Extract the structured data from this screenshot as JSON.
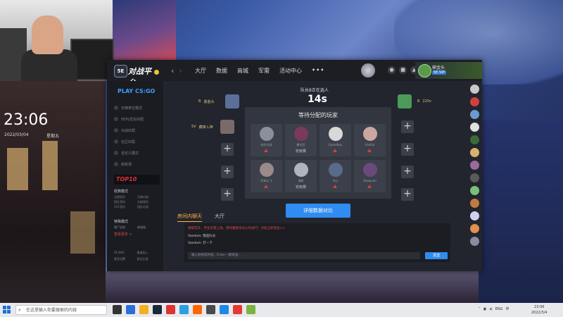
{
  "overlay": {
    "clock": "23:06",
    "date": "2022/03/04",
    "weekday": "星期五"
  },
  "app": {
    "logo_badge": "5E",
    "logo_text": "对战平台",
    "nav": [
      "大厅",
      "数据",
      "商城",
      "军需",
      "活动中心",
      "•••"
    ],
    "user": {
      "name": "鼎金头",
      "tag": "5E VIP"
    }
  },
  "sidebar": {
    "play_label": "PLAY CS:GO",
    "menu": [
      "天梯排位模式",
      "5EPL优先匹配",
      "对战匹配",
      "社区匹配",
      "自定义模式",
      "练枪场"
    ],
    "top_banner": "TOP10",
    "classic": {
      "title": "经典模式",
      "items": [
        "全模竞技",
        "天梯对战",
        "团队竞技",
        "天梯竞技",
        "1V1竞技",
        "组队对战"
      ]
    },
    "special": {
      "title": "特殊模式",
      "items": [
        "僵尸逃跑",
        "躲猫猫"
      ]
    },
    "more": "查看更多 >",
    "footer": [
      "5E BOX",
      "邀请加入",
      "更多设置",
      "意见反馈"
    ]
  },
  "lobby": {
    "left_players": [
      {
        "name": "鼎金头",
        "rank": "B"
      },
      {
        "name": "藏锋入神",
        "rank": "5V"
      }
    ],
    "right_player": {
      "name": "220v",
      "rank": "B"
    },
    "queue_text": "队长8正在选人",
    "countdown": "14s",
    "panel_title": "等待分配的玩家",
    "candidates": [
      {
        "name": "哈尔大叔",
        "rank": "▲"
      },
      {
        "name": "暴力狂",
        "rank": "宏级赛"
      },
      {
        "name": "GameBoy",
        "rank": "▲"
      },
      {
        "name": "Vanilla",
        "rank": "▲"
      },
      {
        "name": "邓禾大飞",
        "rank": "▲"
      },
      {
        "name": "清新",
        "rank": "宏级赛"
      },
      {
        "name": "冷心",
        "rank": "▲"
      },
      {
        "name": "Xiaoyuan",
        "rank": "▲"
      }
    ],
    "detail_button": "详细数据对比"
  },
  "chat": {
    "tabs": [
      "房间内聊天",
      "大厅"
    ],
    "system_message": "春暖花开，势生军需上线，限时置换活动火热进行！点此立即前往>>",
    "messages": [
      {
        "user": "Vaedom",
        "text": "我是队长"
      },
      {
        "user": "Vaedom",
        "text": "打一下"
      }
    ],
    "input_placeholder": "输入你想说的话，Enter一键发送...",
    "send_label": "发送"
  },
  "taskbar": {
    "search_placeholder": "在这里输入你要搜索的内容",
    "tray_lang": "ENG",
    "time": "23:06",
    "date": "2022/3/4"
  }
}
